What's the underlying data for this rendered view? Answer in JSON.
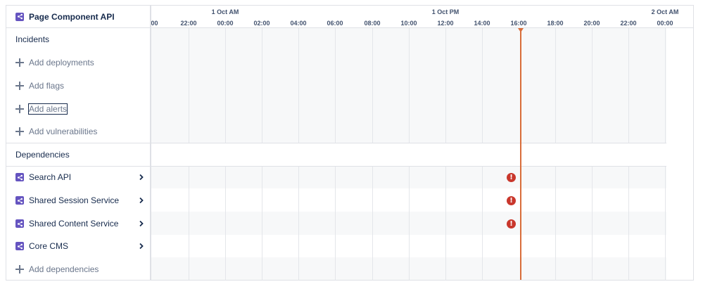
{
  "header": {
    "title": "Page Component API",
    "icon": "service-share-icon"
  },
  "timeline": {
    "dates": [
      {
        "label": "1 Oct AM",
        "at_hour": "00:00"
      },
      {
        "label": "1 Oct PM",
        "at_hour": "12:00"
      },
      {
        "label": "2 Oct AM",
        "at_hour": "00:00 (next day)"
      }
    ],
    "hours": [
      ":00",
      "22:00",
      "00:00",
      "02:00",
      "04:00",
      "06:00",
      "08:00",
      "10:00",
      "12:00",
      "14:00",
      "16:00",
      "18:00",
      "20:00",
      "22:00",
      "00:00"
    ],
    "current_time": "16:00",
    "now_color": "#d96d3a"
  },
  "incidents": {
    "label": "Incidents",
    "actions": [
      {
        "label": "Add deployments"
      },
      {
        "label": "Add flags"
      },
      {
        "label": "Add alerts",
        "focused": true
      },
      {
        "label": "Add vulnerabilities"
      }
    ]
  },
  "dependencies": {
    "label": "Dependencies",
    "items": [
      {
        "label": "Search API",
        "alert": true
      },
      {
        "label": "Shared Session Service",
        "alert": true
      },
      {
        "label": "Shared Content Service",
        "alert": true
      },
      {
        "label": "Core CMS",
        "alert": false
      }
    ],
    "add_label": "Add dependencies",
    "alert_glyph": "!",
    "alert_color": "#c9372c"
  },
  "colors": {
    "service_icon": "#6554c0",
    "band": "#f7f8f9",
    "border": "#dfe1e6"
  }
}
